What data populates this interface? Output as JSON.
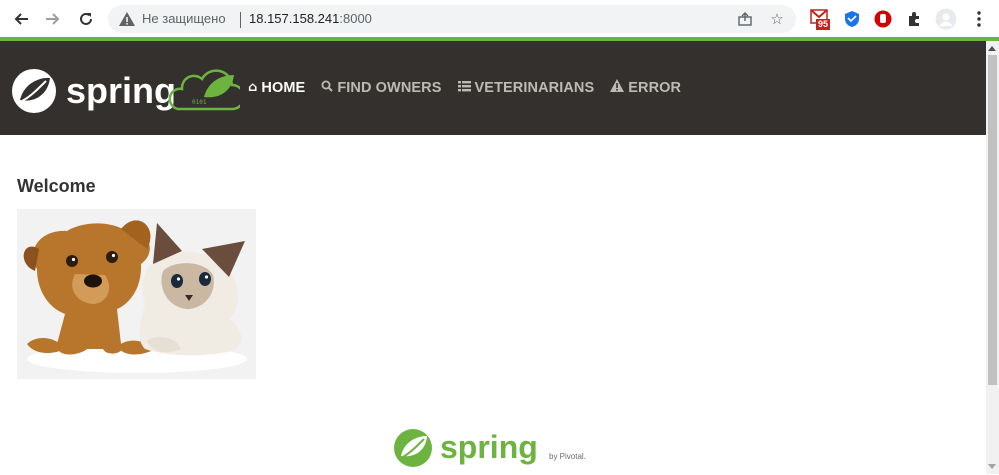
{
  "browser": {
    "security_label": "Не защищено",
    "url_host": "18.157.158.241",
    "url_port": ":8000",
    "extensions": {
      "gmail_badge": "95"
    }
  },
  "nav": {
    "brand": "spring",
    "items": [
      {
        "label": "HOME",
        "icon": "home-icon",
        "active": true
      },
      {
        "label": "FIND OWNERS",
        "icon": "search-icon",
        "active": false
      },
      {
        "label": "VETERINARIANS",
        "icon": "list-icon",
        "active": false
      },
      {
        "label": "ERROR",
        "icon": "warning-icon",
        "active": false
      }
    ]
  },
  "main": {
    "heading": "Welcome"
  },
  "footer": {
    "brand": "spring",
    "byline": "by Pivotal."
  },
  "colors": {
    "spring_green": "#6db33f",
    "navbar_bg": "#34302d",
    "nav_text": "#bdbab6"
  }
}
